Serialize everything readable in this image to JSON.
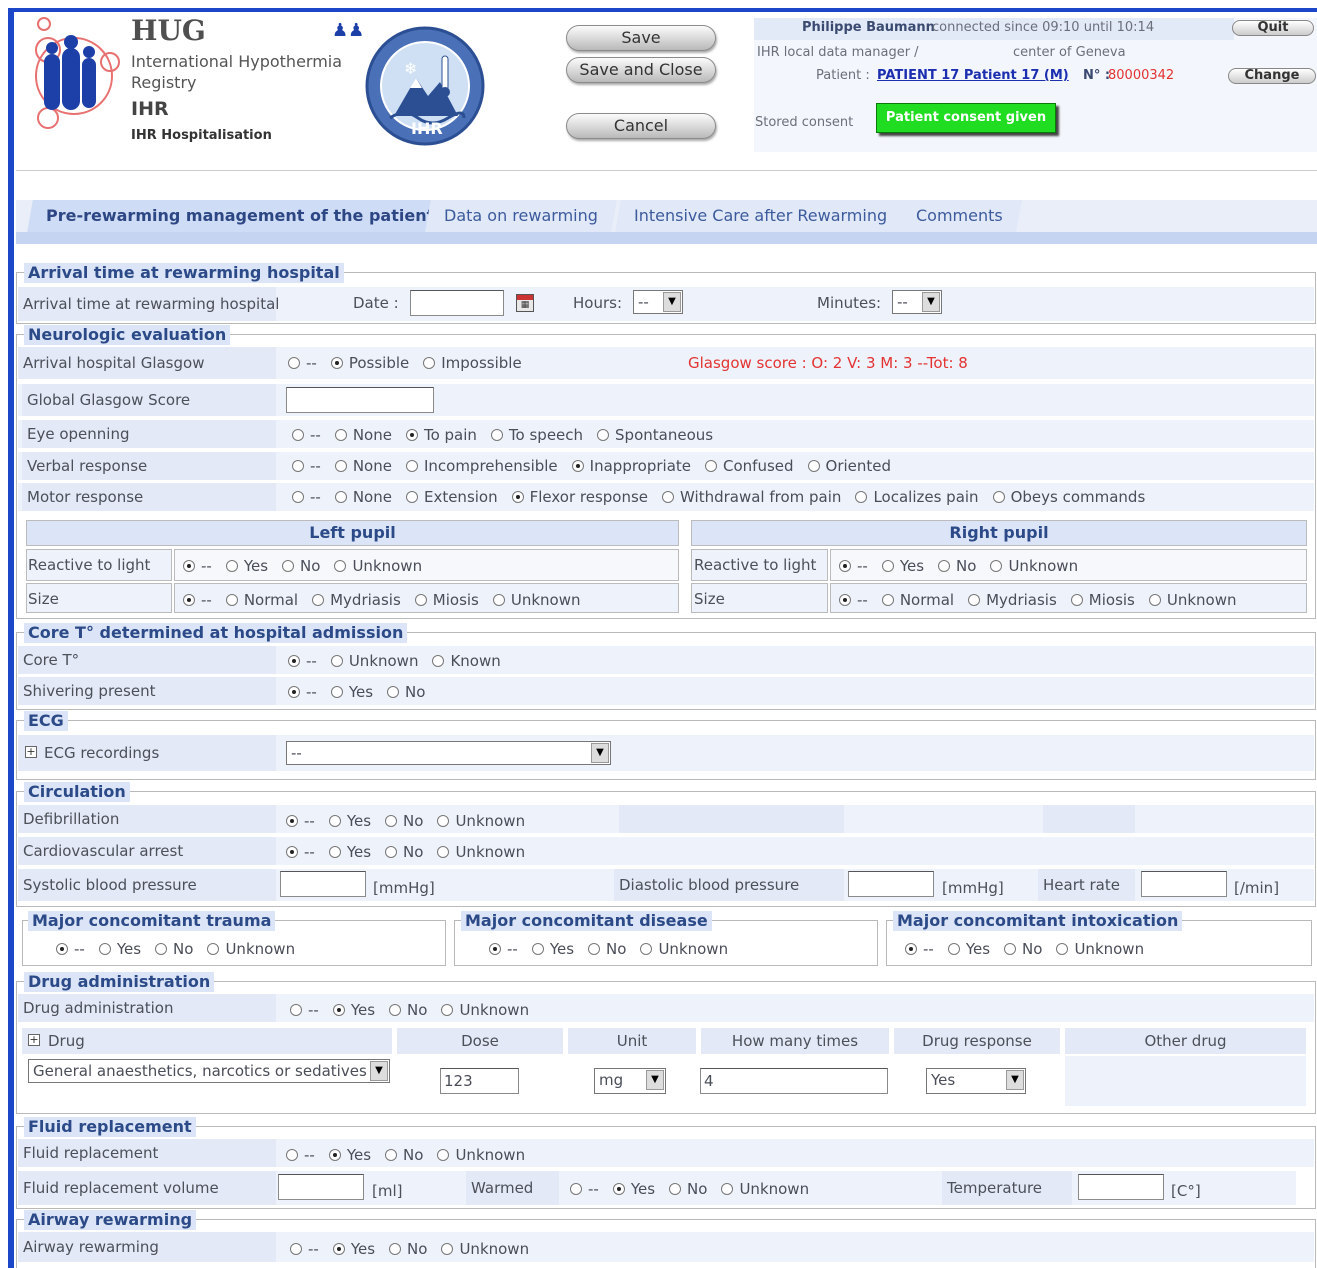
{
  "header": {
    "org": "HUG",
    "registry_line1": "International Hypothermia",
    "registry_line2": "Registry",
    "acronym": "IHR",
    "module": "IHR Hospitalisation",
    "seal_text": "IHR",
    "buttons": {
      "save": "Save",
      "save_close": "Save and Close",
      "cancel": "Cancel"
    }
  },
  "user": {
    "name": "Philippe Baumann",
    "session": "connected since 09:10 until 10:14",
    "quit": "Quit",
    "role": "IHR local data manager /",
    "center": "center of Geneva",
    "patient_label": "Patient :",
    "patient_link": "PATIENT 17 Patient 17   (M)",
    "number_label": "N° :",
    "number": "80000342",
    "change": "Change",
    "stored_consent": "Stored consent",
    "consent_button": "Patient consent given"
  },
  "tabs": [
    {
      "label": "Pre-rewarming management of the patient",
      "active": true
    },
    {
      "label": "Data on rewarming",
      "active": false
    },
    {
      "label": "Intensive Care after Rewarming",
      "active": false
    },
    {
      "label": "Comments",
      "active": false
    }
  ],
  "arrival": {
    "section": "Arrival time at rewarming hospital",
    "label": "Arrival time at rewarming hospital",
    "date_label": "Date :",
    "date_value": "",
    "hours_label": "Hours:",
    "hours_value": "--",
    "minutes_label": "Minutes:",
    "minutes_value": "--"
  },
  "neuro": {
    "section": "Neurologic evaluation",
    "glasgow_label": "Arrival hospital Glasgow",
    "glasgow_options": [
      "--",
      "Possible",
      "Impossible"
    ],
    "glasgow_selected": 1,
    "glasgow_score": "Glasgow score : O: 2 V: 3 M: 3 --Tot: 8",
    "global_label": "Global Glasgow Score",
    "global_value": "",
    "eye_label": "Eye openning",
    "eye_options": [
      "--",
      "None",
      "To pain",
      "To speech",
      "Spontaneous"
    ],
    "eye_selected": 2,
    "verbal_label": "Verbal response",
    "verbal_options": [
      "--",
      "None",
      "Incomprehensible",
      "Inappropriate",
      "Confused",
      "Oriented"
    ],
    "verbal_selected": 3,
    "motor_label": "Motor response",
    "motor_options": [
      "--",
      "None",
      "Extension",
      "Flexor response",
      "Withdrawal from pain",
      "Localizes pain",
      "Obeys commands"
    ],
    "motor_selected": 3,
    "left_pupil": "Left pupil",
    "right_pupil": "Right pupil",
    "reactive_label": "Reactive to light",
    "reactive_options": [
      "--",
      "Yes",
      "No",
      "Unknown"
    ],
    "size_label": "Size",
    "size_options": [
      "--",
      "Normal",
      "Mydriasis",
      "Miosis",
      "Unknown"
    ]
  },
  "core": {
    "section": "Core T° determined at hospital admission",
    "core_label": "Core T°",
    "core_options": [
      "--",
      "Unknown",
      "Known"
    ],
    "shiver_label": "Shivering present",
    "shiver_options": [
      "--",
      "Yes",
      "No"
    ]
  },
  "ecg": {
    "section": "ECG",
    "label": "ECG recordings",
    "value": "--"
  },
  "circulation": {
    "section": "Circulation",
    "defib_label": "Defibrillation",
    "arrest_label": "Cardiovascular arrest",
    "options": [
      "--",
      "Yes",
      "No",
      "Unknown"
    ],
    "sys_label": "Systolic blood pressure",
    "unit_mmhg": "[mmHg]",
    "dia_label": "Diastolic blood pressure",
    "hr_label": "Heart rate",
    "hr_unit": "[/min]"
  },
  "concomitant": {
    "trauma": "Major concomitant trauma",
    "disease": "Major concomitant disease",
    "intox": "Major concomitant intoxication",
    "options": [
      "--",
      "Yes",
      "No",
      "Unknown"
    ]
  },
  "drug": {
    "section": "Drug administration",
    "label": "Drug administration",
    "options": [
      "--",
      "Yes",
      "No",
      "Unknown"
    ],
    "selected": 1,
    "col_drug": "Drug",
    "col_dose": "Dose",
    "col_unit": "Unit",
    "col_times": "How many times",
    "col_response": "Drug response",
    "col_other": "Other drug",
    "drug_value": "General anaesthetics, narcotics or sedatives",
    "dose_value": "123",
    "unit_value": "mg",
    "times_value": "4",
    "response_value": "Yes"
  },
  "fluid": {
    "section": "Fluid replacement",
    "label": "Fluid replacement",
    "options": [
      "--",
      "Yes",
      "No",
      "Unknown"
    ],
    "selected": 1,
    "volume_label": "Fluid replacement volume",
    "volume_unit": "[ml]",
    "warmed_label": "Warmed",
    "temp_label": "Temperature",
    "temp_unit": "[C°]"
  },
  "airway": {
    "section": "Airway rewarming",
    "label": "Airway rewarming",
    "options": [
      "--",
      "Yes",
      "No",
      "Unknown"
    ],
    "selected": 1
  }
}
